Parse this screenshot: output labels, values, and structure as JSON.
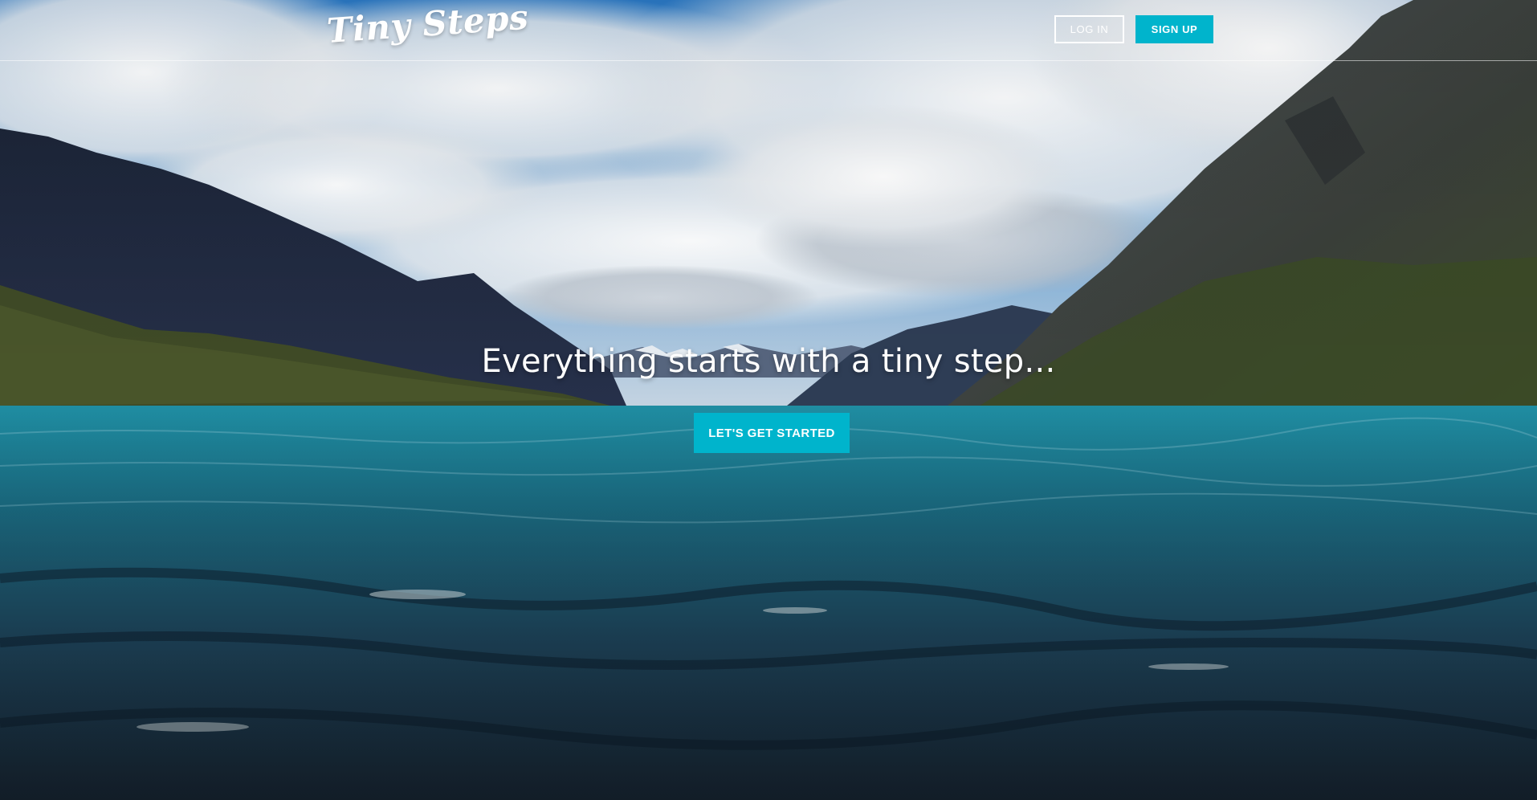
{
  "header": {
    "logo_text": "Tiny Steps",
    "login_label": "LOG IN",
    "signup_label": "SIGN UP"
  },
  "hero": {
    "headline": "Everything starts with a tiny step...",
    "cta_label": "LET'S GET STARTED"
  },
  "colors": {
    "accent": "#00b4cc",
    "text": "#ffffff",
    "sky": "#2f7fc4",
    "water": "#1d7f95"
  }
}
